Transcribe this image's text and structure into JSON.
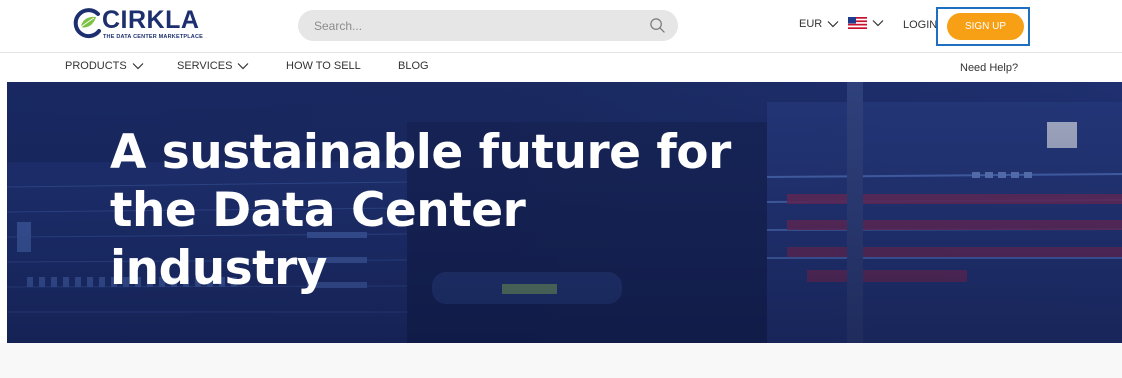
{
  "brand": {
    "name": "CIRKLA",
    "tagline": "THE DATA CENTER MARKETPLACE"
  },
  "search": {
    "placeholder": "Search..."
  },
  "header": {
    "currency": "EUR",
    "login_label": "LOGIN",
    "signup_label": "SIGN UP"
  },
  "nav": {
    "items": [
      {
        "label": "PRODUCTS",
        "has_dropdown": true
      },
      {
        "label": "SERVICES",
        "has_dropdown": true
      },
      {
        "label": "HOW TO SELL",
        "has_dropdown": false
      },
      {
        "label": "BLOG",
        "has_dropdown": false
      }
    ],
    "help_label": "Need Help?"
  },
  "hero": {
    "title_lines": [
      "A sustainable future for",
      "the Data Center",
      "industry"
    ]
  },
  "colors": {
    "accent": "#f7a015",
    "brand_navy": "#1d2f6e",
    "highlight_frame": "#1f6fc1",
    "hero_overlay": "#1a2f6c"
  }
}
